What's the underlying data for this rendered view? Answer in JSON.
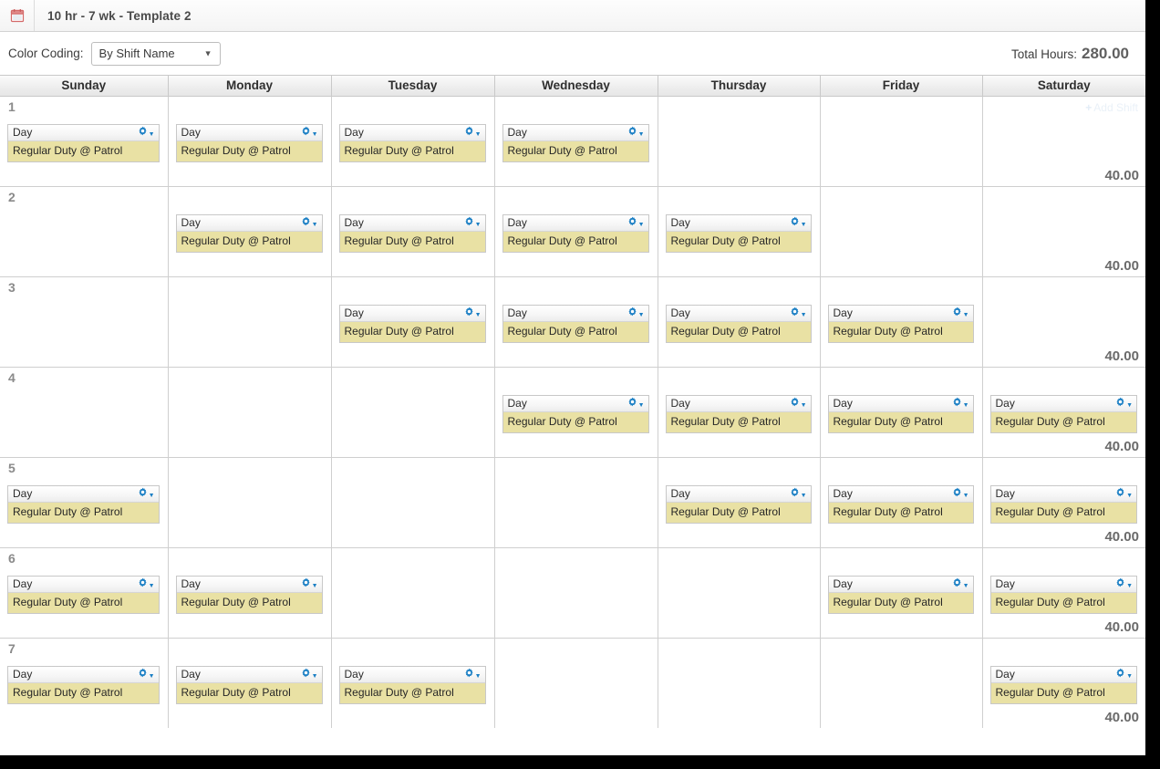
{
  "window": {
    "icon": "calendar-icon",
    "title": "10 hr - 7 wk - Template 2"
  },
  "toolbar": {
    "color_coding_label": "Color Coding:",
    "color_coding_value": "By Shift Name",
    "color_coding_options": [
      "By Shift Name"
    ],
    "total_hours_label": "Total Hours:",
    "total_hours_value": "280.00"
  },
  "calendar": {
    "day_headers": [
      "Sunday",
      "Monday",
      "Tuesday",
      "Wednesday",
      "Thursday",
      "Friday",
      "Saturday"
    ],
    "add_shift_label": "+ Add Shift",
    "add_shift_plus": "+",
    "add_shift_text": "Add Shift",
    "shift_name": "Day",
    "shift_detail": "Regular Duty @ Patrol",
    "gear_icon": "gear-icon",
    "gear_caret": "▾",
    "rows": [
      {
        "number": "1",
        "total": "40.00",
        "shifts": [
          true,
          true,
          true,
          true,
          false,
          false,
          false
        ],
        "add_shift_col": 6
      },
      {
        "number": "2",
        "total": "40.00",
        "shifts": [
          false,
          true,
          true,
          true,
          true,
          false,
          false
        ],
        "add_shift_col": -1
      },
      {
        "number": "3",
        "total": "40.00",
        "shifts": [
          false,
          false,
          true,
          true,
          true,
          true,
          false
        ],
        "add_shift_col": -1
      },
      {
        "number": "4",
        "total": "40.00",
        "shifts": [
          false,
          false,
          false,
          true,
          true,
          true,
          true
        ],
        "add_shift_col": -1
      },
      {
        "number": "5",
        "total": "40.00",
        "shifts": [
          true,
          false,
          false,
          false,
          true,
          true,
          true
        ],
        "add_shift_col": -1
      },
      {
        "number": "6",
        "total": "40.00",
        "shifts": [
          true,
          true,
          false,
          false,
          false,
          true,
          true
        ],
        "add_shift_col": -1
      },
      {
        "number": "7",
        "total": "40.00",
        "shifts": [
          true,
          true,
          true,
          false,
          false,
          false,
          true
        ],
        "add_shift_col": -1
      }
    ]
  },
  "colors": {
    "shift_body": "#e9e1a4",
    "gear_blue": "#1b7fc4",
    "header_text": "#2f2f2f",
    "row_number": "#8a8a8a"
  }
}
